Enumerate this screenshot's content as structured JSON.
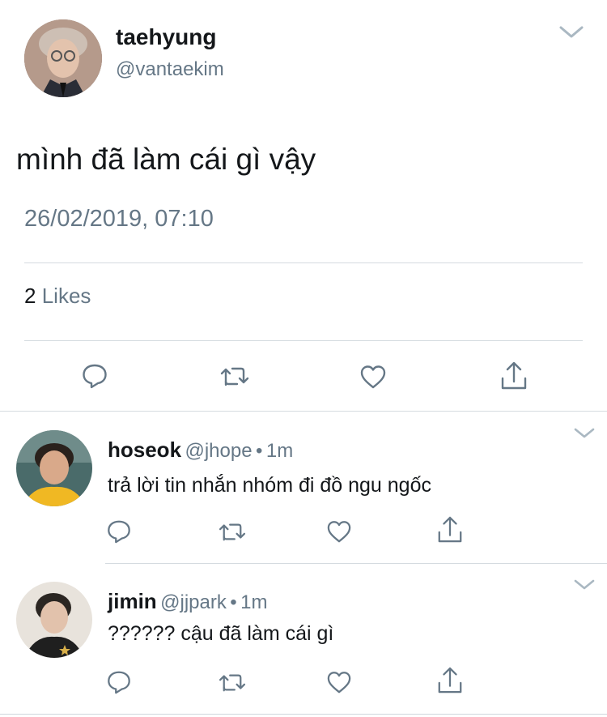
{
  "tweet": {
    "author_name": "taehyung",
    "author_handle": "@vantaekim",
    "text": "mình đã làm cái gì vậy",
    "timestamp": "26/02/2019, 07:10",
    "likes_count": "2",
    "likes_label": "Likes"
  },
  "replies": [
    {
      "name": "hoseok",
      "handle": "@jhope",
      "separator": "•",
      "time": "1m",
      "text": "trả lời tin nhắn nhóm đi đồ ngu ngốc"
    },
    {
      "name": "jimin",
      "handle": "@jjpark",
      "separator": "•",
      "time": "1m",
      "text": "?????? cậu đã làm cái gì"
    }
  ],
  "icons": {
    "menu": "chevron-down-icon",
    "reply": "reply-icon",
    "retweet": "retweet-icon",
    "like": "heart-icon",
    "share": "share-icon"
  },
  "colors": {
    "text": "#14171a",
    "secondary": "#657786",
    "divider": "#d5dbe0"
  }
}
